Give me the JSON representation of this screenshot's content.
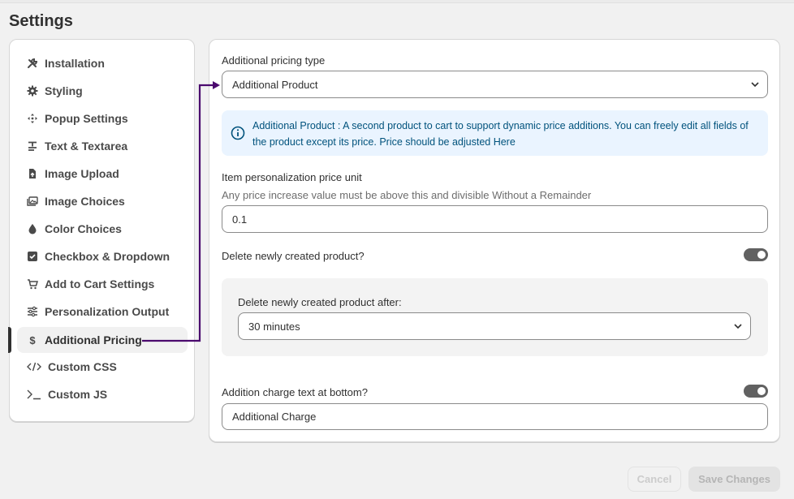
{
  "page": {
    "title": "Settings"
  },
  "sidebar": {
    "items": [
      {
        "label": "Installation",
        "icon": "wrench-icon"
      },
      {
        "label": "Styling",
        "icon": "gear-icon"
      },
      {
        "label": "Popup Settings",
        "icon": "move-icon"
      },
      {
        "label": "Text & Textarea",
        "icon": "text-icon"
      },
      {
        "label": "Image Upload",
        "icon": "file-upload-icon"
      },
      {
        "label": "Image Choices",
        "icon": "images-icon"
      },
      {
        "label": "Color Choices",
        "icon": "droplet-icon"
      },
      {
        "label": "Checkbox & Dropdown",
        "icon": "checkbox-icon"
      },
      {
        "label": "Add to Cart Settings",
        "icon": "cart-icon"
      },
      {
        "label": "Personalization Output",
        "icon": "sliders-icon"
      },
      {
        "label": "Additional Pricing",
        "icon": "dollar-icon"
      },
      {
        "label": "Custom CSS",
        "icon": "code-icon"
      },
      {
        "label": "Custom JS",
        "icon": "terminal-icon"
      }
    ],
    "active_index": 10
  },
  "form": {
    "pricing_type": {
      "label": "Additional pricing type",
      "value": "Additional Product"
    },
    "info_banner": {
      "text": "Additional Product : A second product to cart to support dynamic price additions. You can freely edit all fields of the product except its price. Price should be adjusted Here"
    },
    "price_unit": {
      "label": "Item personalization price unit",
      "hint": "Any price increase value must be above this and divisible Without a Remainder",
      "value": "0.1"
    },
    "delete_product": {
      "label": "Delete newly created product?",
      "enabled": true
    },
    "delete_after": {
      "label": "Delete newly created product after:",
      "value": "30 minutes"
    },
    "charge_text": {
      "label": "Addition charge text at bottom?",
      "enabled": true,
      "value": "Additional Charge"
    }
  },
  "footer": {
    "cancel_label": "Cancel",
    "save_label": "Save Changes"
  },
  "colors": {
    "annotation_arrow": "#4b0a6e",
    "info_bg": "#eaf4ff",
    "info_text": "#00527c",
    "toggle_on": "#616161"
  }
}
